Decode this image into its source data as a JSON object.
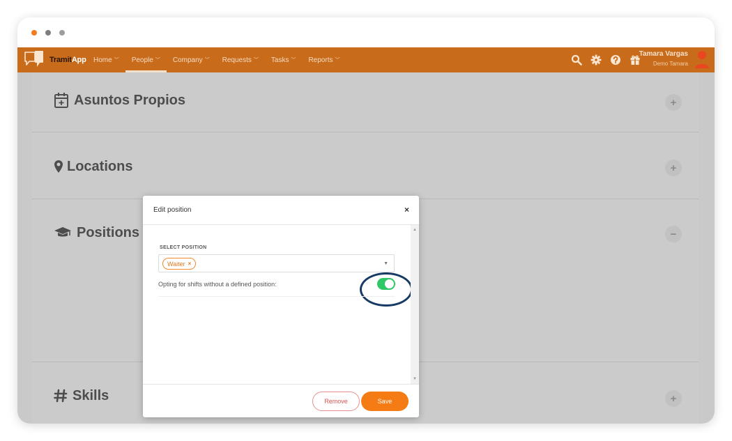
{
  "app": {
    "logo_part1": "Tramit",
    "logo_part2": "App",
    "brand_color": "#c86b1a",
    "accent_color": "#f57b14"
  },
  "nav": {
    "items": [
      {
        "label": "Home",
        "active": false
      },
      {
        "label": "People",
        "active": true
      },
      {
        "label": "Company",
        "active": false
      },
      {
        "label": "Requests",
        "active": false
      },
      {
        "label": "Tasks",
        "active": false
      },
      {
        "label": "Reports",
        "active": false
      }
    ],
    "icons": [
      "search-icon",
      "gear-icon",
      "help-icon",
      "gift-icon"
    ]
  },
  "user": {
    "name": "Tamara Vargas",
    "company": "Demo Tamara"
  },
  "sections": [
    {
      "title": "Asuntos Propios",
      "icon": "calendar-plus-icon",
      "toggle": "+"
    },
    {
      "title": "Locations",
      "icon": "map-marker-icon",
      "toggle": "+"
    },
    {
      "title": "Positions",
      "icon": "graduation-cap-icon",
      "toggle": "−"
    },
    {
      "title": "Skills",
      "icon": "hashtag-icon",
      "toggle": "+"
    }
  ],
  "modal": {
    "title": "Edit position",
    "close": "×",
    "select_label": "SELECT POSITION",
    "selected_tags": [
      {
        "label": "Waiter",
        "remove": "×"
      }
    ],
    "option_label": "Opting for shifts without a defined position:",
    "toggle_on": true,
    "toggle_color": "#2ec866",
    "remove_label": "Remove",
    "save_label": "Save"
  }
}
